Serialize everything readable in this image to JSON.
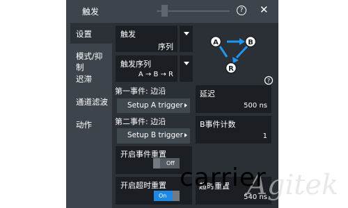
{
  "titlebar": {
    "title": "触发",
    "help_glyph": "?",
    "close_glyph": "✕"
  },
  "sidebar": {
    "items": [
      {
        "label": "设置",
        "active": true
      },
      {
        "label": "模式/抑制",
        "active": false
      },
      {
        "label": "迟滞",
        "active": false
      },
      {
        "label": "通道滤波",
        "active": false
      },
      {
        "label": "动作",
        "active": false
      }
    ]
  },
  "trigger": {
    "label": "触发",
    "value": "序列"
  },
  "trigger_sequence": {
    "label": "触发序列",
    "value": "A → B → R"
  },
  "diagram": {
    "node_a": "A",
    "node_b": "B",
    "node_r": "R",
    "help_glyph": "?"
  },
  "first_event": {
    "label": "第一事件: 边沿",
    "button": "Setup A trigger"
  },
  "second_event": {
    "label": "第二事件: 边沿",
    "button": "Setup B trigger"
  },
  "delay": {
    "label": "延迟",
    "value": "500 ns"
  },
  "b_event_count": {
    "label": "B事件计数",
    "value": "1"
  },
  "enable_event_reset": {
    "label": "开启事件重置",
    "state": "Off"
  },
  "enable_timeout_reset": {
    "label": "开启超时重置",
    "state": "On"
  },
  "timeout_reset": {
    "label": "超时重置",
    "value": "540 ns"
  },
  "watermark": {
    "text1": "carrier",
    "text2": "Agitek"
  },
  "colors": {
    "panel": "#3e444b",
    "content_bg": "#2b3036",
    "field_bg": "#1b1f23",
    "button_bg": "#404850",
    "toggle_on": "#1e88e5",
    "diagram_blue": "#2196f3"
  }
}
